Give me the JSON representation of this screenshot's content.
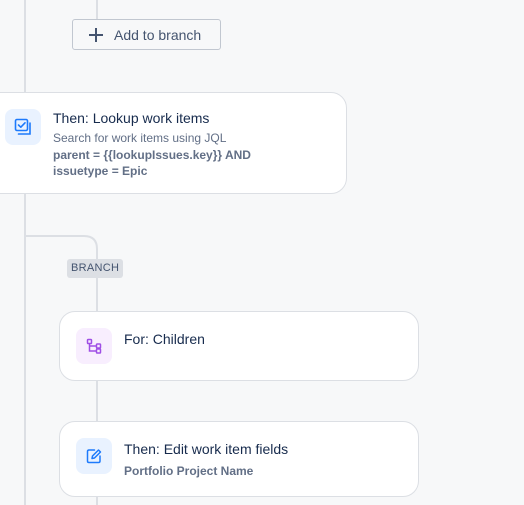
{
  "add_to_branch": {
    "label": "Add to branch",
    "icon": "plus-icon"
  },
  "lookup_card": {
    "title": "Then: Lookup work items",
    "subtitle": "Search for work items using JQL",
    "query": "parent = {{lookupIssues.key}} AND issuetype = Epic",
    "icon": "lookup-issues-icon",
    "icon_color": "#1d7afc"
  },
  "branch": {
    "label": "BRANCH"
  },
  "for_card": {
    "title": "For: Children",
    "icon": "branch-children-icon",
    "icon_color": "#9f4fe5"
  },
  "edit_card": {
    "title": "Then: Edit work item fields",
    "field": "Portfolio Project Name",
    "icon": "edit-icon",
    "icon_color": "#1d7afc"
  }
}
